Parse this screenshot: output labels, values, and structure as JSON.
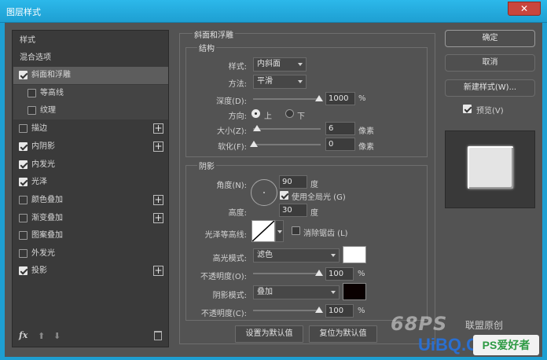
{
  "window": {
    "title": "图层样式",
    "close_glyph": "✕"
  },
  "left_panel": {
    "styles_header": "样式",
    "blend_options": "混合选项",
    "items": [
      {
        "label": "斜面和浮雕",
        "checked": true,
        "selected": true
      },
      {
        "label": "等高线",
        "checked": false,
        "sub": true
      },
      {
        "label": "纹理",
        "checked": false,
        "sub": true
      },
      {
        "label": "描边",
        "checked": false,
        "plus": true
      },
      {
        "label": "内阴影",
        "checked": true,
        "plus": true
      },
      {
        "label": "内发光",
        "checked": true
      },
      {
        "label": "光泽",
        "checked": true
      },
      {
        "label": "颜色叠加",
        "checked": false,
        "plus": true
      },
      {
        "label": "渐变叠加",
        "checked": false,
        "plus": true
      },
      {
        "label": "图案叠加",
        "checked": false
      },
      {
        "label": "外发光",
        "checked": false
      },
      {
        "label": "投影",
        "checked": true,
        "plus": true
      }
    ],
    "footer": {
      "fx": "fx",
      "up": "⬆",
      "down": "⬇",
      "trash": "trash-icon"
    }
  },
  "bevel": {
    "section_title": "斜面和浮雕",
    "structure_title": "结构",
    "style_label": "样式:",
    "style_value": "内斜面",
    "method_label": "方法:",
    "method_value": "平滑",
    "depth_label": "深度(D):",
    "depth_value": "1000",
    "depth_unit": "%",
    "direction_label": "方向:",
    "dir_up": "上",
    "dir_down": "下",
    "size_label": "大小(Z):",
    "size_value": "6",
    "size_unit": "像素",
    "soften_label": "软化(F):",
    "soften_value": "0",
    "soften_unit": "像素"
  },
  "shading": {
    "title": "阴影",
    "angle_label": "角度(N):",
    "angle_value": "90",
    "angle_unit": "度",
    "global_light_label": "使用全局光 (G)",
    "altitude_label": "高度:",
    "altitude_value": "30",
    "altitude_unit": "度",
    "gloss_contour_label": "光泽等高线:",
    "antialias_label": "消除锯齿 (L)",
    "highlight_mode_label": "高光模式:",
    "highlight_mode_value": "滤色",
    "highlight_color": "#ffffff",
    "highlight_opacity_label": "不透明度(O):",
    "highlight_opacity_value": "100",
    "highlight_opacity_unit": "%",
    "shadow_mode_label": "阴影模式:",
    "shadow_mode_value": "叠加",
    "shadow_color": "#0a0000",
    "shadow_opacity_label": "不透明度(C):",
    "shadow_opacity_value": "100",
    "shadow_opacity_unit": "%"
  },
  "bottom_buttons": {
    "set_default": "设置为默认值",
    "reset_default": "复位为默认值"
  },
  "right_buttons": {
    "ok": "确定",
    "cancel": "取消",
    "new_style": "新建样式(W)...",
    "preview": "预览(V)"
  },
  "watermark": {
    "logo": "68PS",
    "tag": "联盟原创",
    "site": "UiBQ.CoM",
    "badge": "PS爱好者"
  }
}
